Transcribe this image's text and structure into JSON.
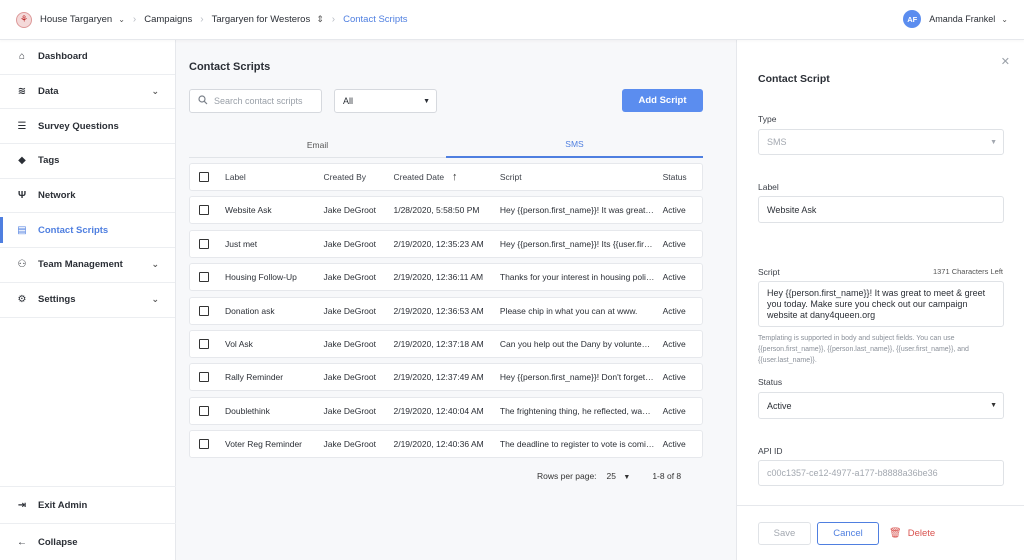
{
  "topbar": {
    "org": "House Targaryen",
    "campaigns": "Campaigns",
    "campaign": "Targaryen for Westeros",
    "current": "Contact Scripts",
    "user_initials": "AF",
    "user_name": "Amanda Frankel"
  },
  "sidebar": {
    "items": [
      {
        "label": "Dashboard",
        "icon": "home-icon"
      },
      {
        "label": "Data",
        "icon": "layers-icon",
        "has_caret": true
      },
      {
        "label": "Survey Questions",
        "icon": "list-icon"
      },
      {
        "label": "Tags",
        "icon": "tag-icon"
      },
      {
        "label": "Network",
        "icon": "network-icon"
      },
      {
        "label": "Contact Scripts",
        "icon": "message-icon",
        "active": true
      },
      {
        "label": "Team Management",
        "icon": "team-icon",
        "has_caret": true
      },
      {
        "label": "Settings",
        "icon": "gear-icon",
        "has_caret": true
      }
    ],
    "exit_admin": "Exit Admin",
    "collapse": "Collapse"
  },
  "main": {
    "title": "Contact Scripts",
    "search_placeholder": "Search contact scripts",
    "filter_value": "All",
    "add_button": "Add Script",
    "tabs": [
      "Email",
      "SMS"
    ],
    "active_tab": "SMS",
    "columns": {
      "label": "Label",
      "created_by": "Created By",
      "created_date": "Created Date",
      "script": "Script",
      "status": "Status"
    },
    "rows": [
      {
        "label": "Website Ask",
        "created_by": "Jake DeGroot",
        "date": "1/28/2020, 5:58:50 PM",
        "script": "Hey {{person.first_name}}! It was great to meet & greet you today.",
        "status": "Active"
      },
      {
        "label": "Just met",
        "created_by": "Jake DeGroot",
        "date": "2/19/2020, 12:35:23 AM",
        "script": "Hey {{person.first_name}}! Its {{user.first_name}} here.",
        "status": "Active"
      },
      {
        "label": "Housing Follow-Up",
        "created_by": "Jake DeGroot",
        "date": "2/19/2020, 12:36:11 AM",
        "script": "Thanks for your interest in housing policy.",
        "status": "Active"
      },
      {
        "label": "Donation ask",
        "created_by": "Jake DeGroot",
        "date": "2/19/2020, 12:36:53 AM",
        "script": "Please chip in what you can at www.",
        "status": "Active"
      },
      {
        "label": "Vol Ask",
        "created_by": "Jake DeGroot",
        "date": "2/19/2020, 12:37:18 AM",
        "script": "Can you help out the Dany by volunteering?",
        "status": "Active"
      },
      {
        "label": "Rally Reminder",
        "created_by": "Jake DeGroot",
        "date": "2/19/2020, 12:37:49 AM",
        "script": "Hey {{person.first_name}}! Don't forget the rally.",
        "status": "Active"
      },
      {
        "label": "Doublethink",
        "created_by": "Jake DeGroot",
        "date": "2/19/2020, 12:40:04 AM",
        "script": "The frightening thing, he reflected, was that it might all be true.",
        "status": "Active"
      },
      {
        "label": "Voter Reg Reminder",
        "created_by": "Jake DeGroot",
        "date": "2/19/2020, 12:40:36 AM",
        "script": "The deadline to register to vote is coming up.",
        "status": "Active"
      }
    ],
    "rows_per_page_label": "Rows per page:",
    "rows_per_page": "25",
    "page_range": "1-8 of 8"
  },
  "panel": {
    "title": "Contact Script",
    "type_label": "Type",
    "type_value": "SMS",
    "label_label": "Label",
    "label_value": "Website Ask",
    "script_label": "Script",
    "chars_left": "1371 Characters Left",
    "script_value": "Hey {{person.first_name}}! It was great to meet & greet you today. Make sure you check out our campaign website at dany4queen.org",
    "help_text": "Templating is supported in body and subject fields. You can use {{person.first_name}}, {{person.last_name}}, {{user.first_name}}, and {{user.last_name}}.",
    "status_label": "Status",
    "status_value": "Active",
    "api_label": "API ID",
    "api_value": "c00c1357-ce12-4977-a177-b8888a36be36",
    "save": "Save",
    "cancel": "Cancel",
    "delete": "Delete"
  }
}
